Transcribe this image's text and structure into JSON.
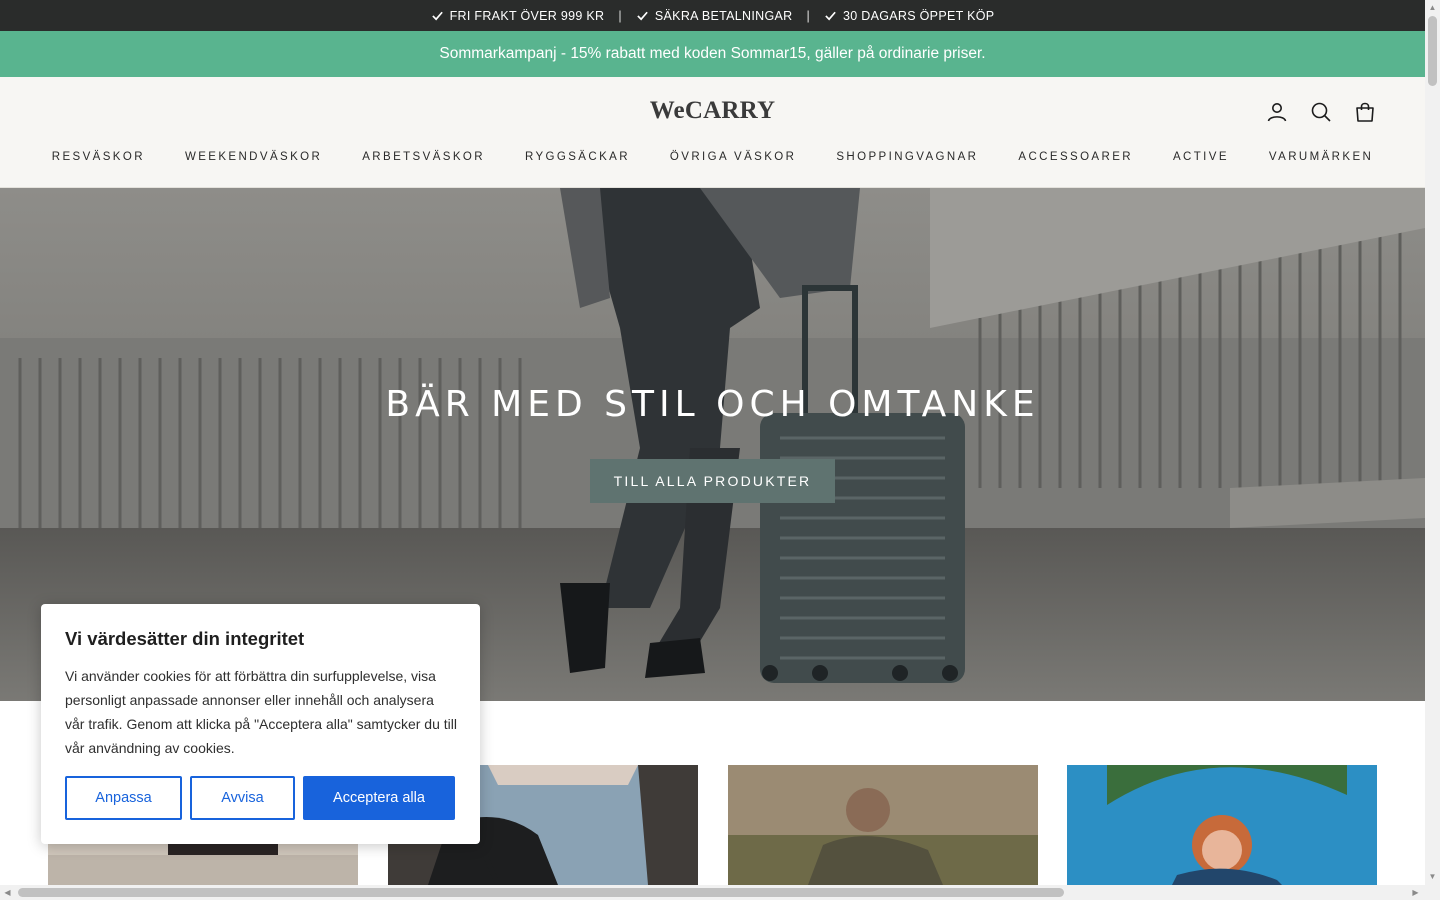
{
  "announcement": {
    "usps": [
      "FRI FRAKT ÖVER 999 KR",
      "SÄKRA BETALNINGAR",
      "30 DAGARS ÖPPET KÖP"
    ],
    "separator": "|"
  },
  "promo": {
    "text": "Sommarkampanj - 15% rabatt med koden Sommar15, gäller på ordinarie priser."
  },
  "header": {
    "logo": "WeCARRY",
    "icons": [
      "account-icon",
      "search-icon",
      "bag-icon"
    ]
  },
  "nav": {
    "items": [
      "RESVÄSKOR",
      "WEEKENDVÄSKOR",
      "ARBETSVÄSKOR",
      "RYGGSÄCKAR",
      "ÖVRIGA VÄSKOR",
      "SHOPPINGVAGNAR",
      "ACCESSOARER",
      "ACTIVE",
      "VARUMÄRKEN"
    ]
  },
  "hero": {
    "title": "BÄR MED STIL OCH OMTANKE",
    "button_label": "TILL ALLA PRODUKTER"
  },
  "cookie": {
    "title": "Vi värdesätter din integritet",
    "body": "Vi använder cookies för att förbättra din surfupplevelse, visa personligt anpassade annonser eller innehåll och analysera vår trafik. Genom att klicka på \"Acceptera alla\" samtycker du till vår användning av cookies.",
    "customize_label": "Anpassa",
    "reject_label": "Avvisa",
    "accept_label": "Acceptera alla"
  },
  "colors": {
    "topbar": "#2a2c2b",
    "promo": "#59b48f",
    "header_bg": "#f7f6f3",
    "hero_button": "#5f7370",
    "cookie_accent": "#1863dc"
  }
}
